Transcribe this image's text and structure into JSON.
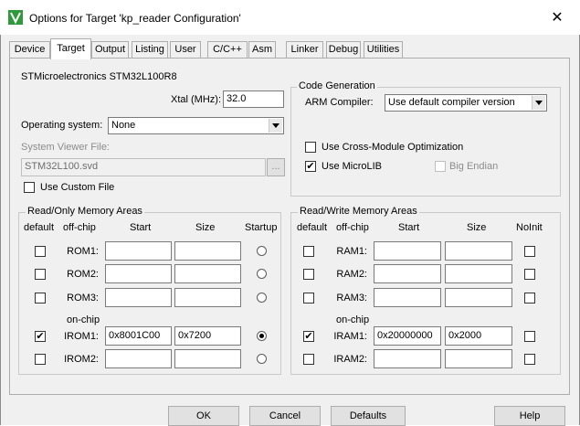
{
  "window": {
    "title": "Options for Target 'kp_reader Configuration'",
    "close_glyph": "✕"
  },
  "tabs": [
    {
      "label": "Device"
    },
    {
      "label": "Target"
    },
    {
      "label": "Output"
    },
    {
      "label": "Listing"
    },
    {
      "label": "User"
    },
    {
      "label": "C/C++"
    },
    {
      "label": "Asm"
    },
    {
      "label": "Linker"
    },
    {
      "label": "Debug"
    },
    {
      "label": "Utilities"
    }
  ],
  "target": {
    "device_name": "STMicroelectronics STM32L100R8",
    "xtal_label": "Xtal (MHz):",
    "xtal_value": "32.0",
    "os_label": "Operating system:",
    "os_value": "None",
    "svd_label": "System Viewer File:",
    "svd_value": "STM32L100.svd",
    "browse_label": "...",
    "custom_file_label": "Use Custom File",
    "custom_file_checked": false
  },
  "code_gen": {
    "title": "Code Generation",
    "compiler_label": "ARM Compiler:",
    "compiler_value": "Use default compiler version",
    "cross_module_label": "Use Cross-Module Optimization",
    "cross_module_checked": false,
    "microlib_label": "Use MicroLIB",
    "microlib_checked": true,
    "big_endian_label": "Big Endian",
    "big_endian_checked": false
  },
  "ro_memory": {
    "title": "Read/Only Memory Areas",
    "headers": {
      "default": "default",
      "offchip": "off-chip",
      "start": "Start",
      "size": "Size",
      "startup": "Startup"
    },
    "onchip_label": "on-chip",
    "rows": [
      {
        "name": "ROM1:",
        "start": "",
        "size": "",
        "default": false,
        "startup": false
      },
      {
        "name": "ROM2:",
        "start": "",
        "size": "",
        "default": false,
        "startup": false
      },
      {
        "name": "ROM3:",
        "start": "",
        "size": "",
        "default": false,
        "startup": false
      },
      {
        "name": "IROM1:",
        "start": "0x8001C00",
        "size": "0x7200",
        "default": true,
        "startup": true
      },
      {
        "name": "IROM2:",
        "start": "",
        "size": "",
        "default": false,
        "startup": false
      }
    ]
  },
  "rw_memory": {
    "title": "Read/Write Memory Areas",
    "headers": {
      "default": "default",
      "offchip": "off-chip",
      "start": "Start",
      "size": "Size",
      "noinit": "NoInit"
    },
    "onchip_label": "on-chip",
    "rows": [
      {
        "name": "RAM1:",
        "start": "",
        "size": "",
        "default": false,
        "noinit": false
      },
      {
        "name": "RAM2:",
        "start": "",
        "size": "",
        "default": false,
        "noinit": false
      },
      {
        "name": "RAM3:",
        "start": "",
        "size": "",
        "default": false,
        "noinit": false
      },
      {
        "name": "IRAM1:",
        "start": "0x20000000",
        "size": "0x2000",
        "default": true,
        "noinit": false
      },
      {
        "name": "IRAM2:",
        "start": "",
        "size": "",
        "default": false,
        "noinit": false
      }
    ]
  },
  "buttons": {
    "ok": "OK",
    "cancel": "Cancel",
    "defaults": "Defaults",
    "help": "Help"
  },
  "check_glyph": "✔"
}
